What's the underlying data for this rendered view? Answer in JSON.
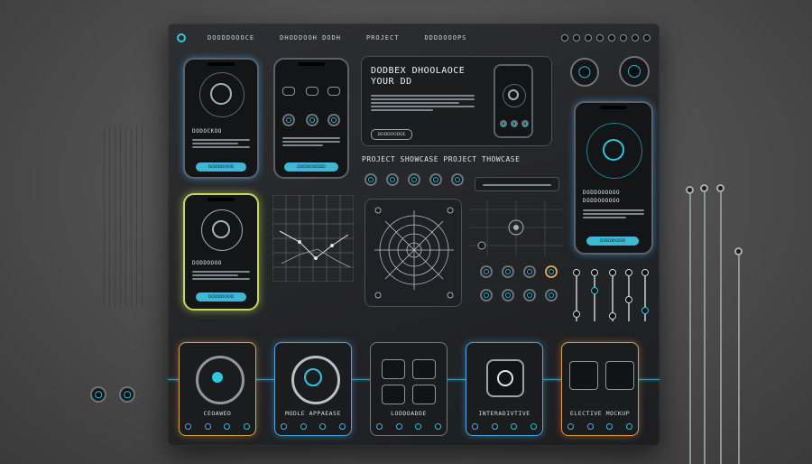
{
  "topbar": {
    "nav": [
      "DOODDOOOCE",
      "DHODDOOH DODH",
      "PROJECT",
      "DDDDOOOPS"
    ]
  },
  "hero": {
    "heading_line1": "DODBEX DHOOLAOCE",
    "heading_line2": "YOUR DD",
    "button": "DODDOODDE"
  },
  "phones": {
    "p1_title": "DODOCKOO",
    "p1_button": "DODDOOOD",
    "p2_button": "DODDOODDD",
    "p3_title": "DODDOOOO",
    "p3_button": "DODDOOOD",
    "p4_title1": "DODDOOOOOO",
    "p4_title2": "DODDOOOOOO",
    "p4_button": "DODDOOOD"
  },
  "showcase": {
    "label": "PROJECT SHOWCASE   PROJECT THOWCASE"
  },
  "bottom_cards": [
    {
      "label": "CEOAWED"
    },
    {
      "label": "MODLE APPAEASE"
    },
    {
      "label": "LODDOADDE"
    },
    {
      "label": "INTERADIVTIVE"
    },
    {
      "label": "ELECTIVE MOCKUP"
    }
  ],
  "colors": {
    "accent": "#2bc6e0",
    "glow_yellow": "#c8d65a",
    "glow_orange": "#e09a4a"
  }
}
